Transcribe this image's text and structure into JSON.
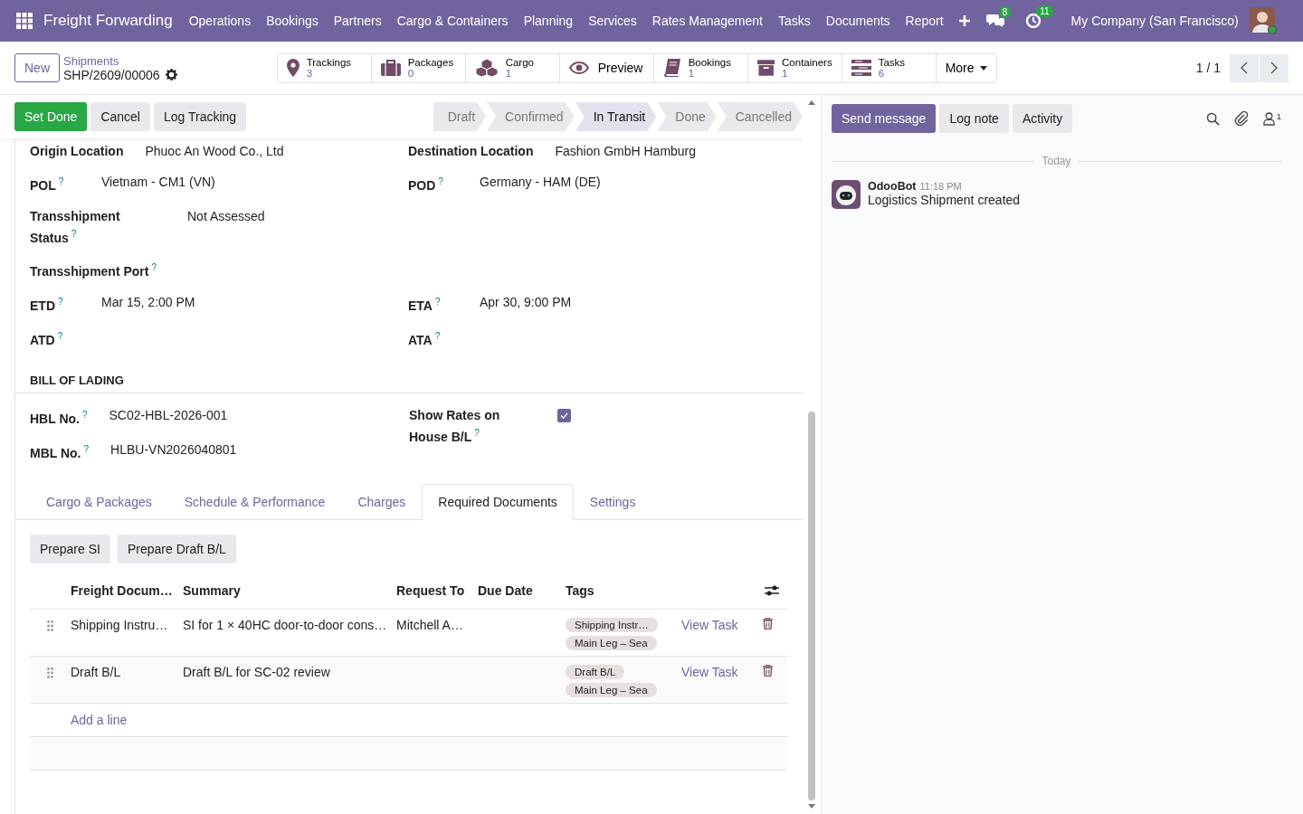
{
  "navbar": {
    "app_name": "Freight Forwarding",
    "menus": [
      "Operations",
      "Bookings",
      "Partners",
      "Cargo & Containers",
      "Planning",
      "Services",
      "Rates Management",
      "Tasks",
      "Documents",
      "Report"
    ],
    "messages_count": "8",
    "activities_count": "11",
    "company": "My Company (San Francisco)"
  },
  "control_panel": {
    "new_button": "New",
    "breadcrumb": "Shipments",
    "record": "SHP/2609/00006",
    "smart_buttons": [
      {
        "kind": "stat",
        "label": "Trackings",
        "value": "3"
      },
      {
        "kind": "stat",
        "label": "Packages",
        "value": "0"
      },
      {
        "kind": "stat",
        "label": "Cargo",
        "value": "1"
      },
      {
        "kind": "action",
        "label": "Preview"
      },
      {
        "kind": "stat",
        "label": "Bookings",
        "value": "1"
      },
      {
        "kind": "stat",
        "label": "Containers",
        "value": "1"
      },
      {
        "kind": "stat",
        "label": "Tasks",
        "value": "6"
      }
    ],
    "more": "More",
    "pager": "1 / 1"
  },
  "action_buttons": [
    {
      "label": "Set Done",
      "kind": "primary"
    },
    {
      "label": "Cancel",
      "kind": "secondary"
    },
    {
      "label": "Log Tracking",
      "kind": "secondary"
    }
  ],
  "statusbar": [
    {
      "label": "Draft",
      "selected": false
    },
    {
      "label": "Confirmed",
      "selected": false
    },
    {
      "label": "In Transit",
      "selected": true
    },
    {
      "label": "Done",
      "selected": false
    },
    {
      "label": "Cancelled",
      "selected": false
    }
  ],
  "field_rows": [
    [
      {
        "label": "Origin Location",
        "value": "Phuoc An Wood Co., Ltd"
      },
      {
        "label": "Destination Location",
        "value": "Fashion GmbH Hamburg"
      }
    ],
    [
      {
        "label": "POL",
        "help": "?",
        "value": "Vietnam - CM1 (VN)"
      },
      {
        "label": "POD",
        "help": "?",
        "value": "Germany - HAM (DE)"
      }
    ],
    [
      {
        "label": "Transshipment Status",
        "help": "?",
        "value": "Not Assessed"
      }
    ],
    [
      {
        "label": "Transshipment Port",
        "help": "?"
      }
    ],
    [
      {
        "label": "ETD",
        "help": "?",
        "value": "Mar 15, 2:00 PM"
      },
      {
        "label": "ETA",
        "help": "?",
        "value": "Apr 30, 9:00 PM"
      }
    ],
    [
      {
        "label": "ATD",
        "help": "?"
      },
      {
        "label": "ATA",
        "help": "?"
      }
    ]
  ],
  "bill_of_lading": {
    "title": "BILL OF LADING",
    "left": [
      {
        "label": "HBL No.",
        "help": "?",
        "value": "SC02-HBL-2026-001"
      },
      {
        "label": "MBL No.",
        "help": "?",
        "value": "HLBU-VN2026040801"
      }
    ],
    "right": [
      {
        "label": "Show Rates on House B/L",
        "help": "?",
        "checked": true
      }
    ]
  },
  "tabs": [
    {
      "label": "Cargo & Packages",
      "selected": false
    },
    {
      "label": "Schedule & Performance",
      "selected": false
    },
    {
      "label": "Charges",
      "selected": false
    },
    {
      "label": "Required Documents",
      "selected": true
    },
    {
      "label": "Settings",
      "selected": false
    }
  ],
  "doc_buttons": [
    "Prepare SI",
    "Prepare Draft B/L"
  ],
  "table": {
    "columns": [
      "Freight Docum…",
      "Summary",
      "Request To",
      "Due Date",
      "Tags"
    ],
    "rows": [
      {
        "document": "Shipping Instru…",
        "summary": "SI for 1 × 40HC door-to-door cons…",
        "request_to": "Mitchell A…",
        "tags": [
          "Shipping Instr…",
          "Main Leg – Sea"
        ],
        "action": "View Task"
      },
      {
        "document": "Draft B/L",
        "summary": "Draft B/L for SC-02 review",
        "tags": [
          "Draft B/L",
          "Main Leg – Sea"
        ],
        "action": "View Task"
      }
    ],
    "add_line": "Add a line"
  },
  "chatter": {
    "buttons": [
      {
        "label": "Send message",
        "kind": "primary"
      },
      {
        "label": "Log note",
        "kind": "secondary"
      },
      {
        "label": "Activity",
        "kind": "secondary"
      }
    ],
    "followers_count": "1",
    "date_separator": "Today",
    "messages": [
      {
        "author": "OdooBot",
        "time": "11:18 PM",
        "body": "Logistics Shipment created"
      }
    ]
  }
}
